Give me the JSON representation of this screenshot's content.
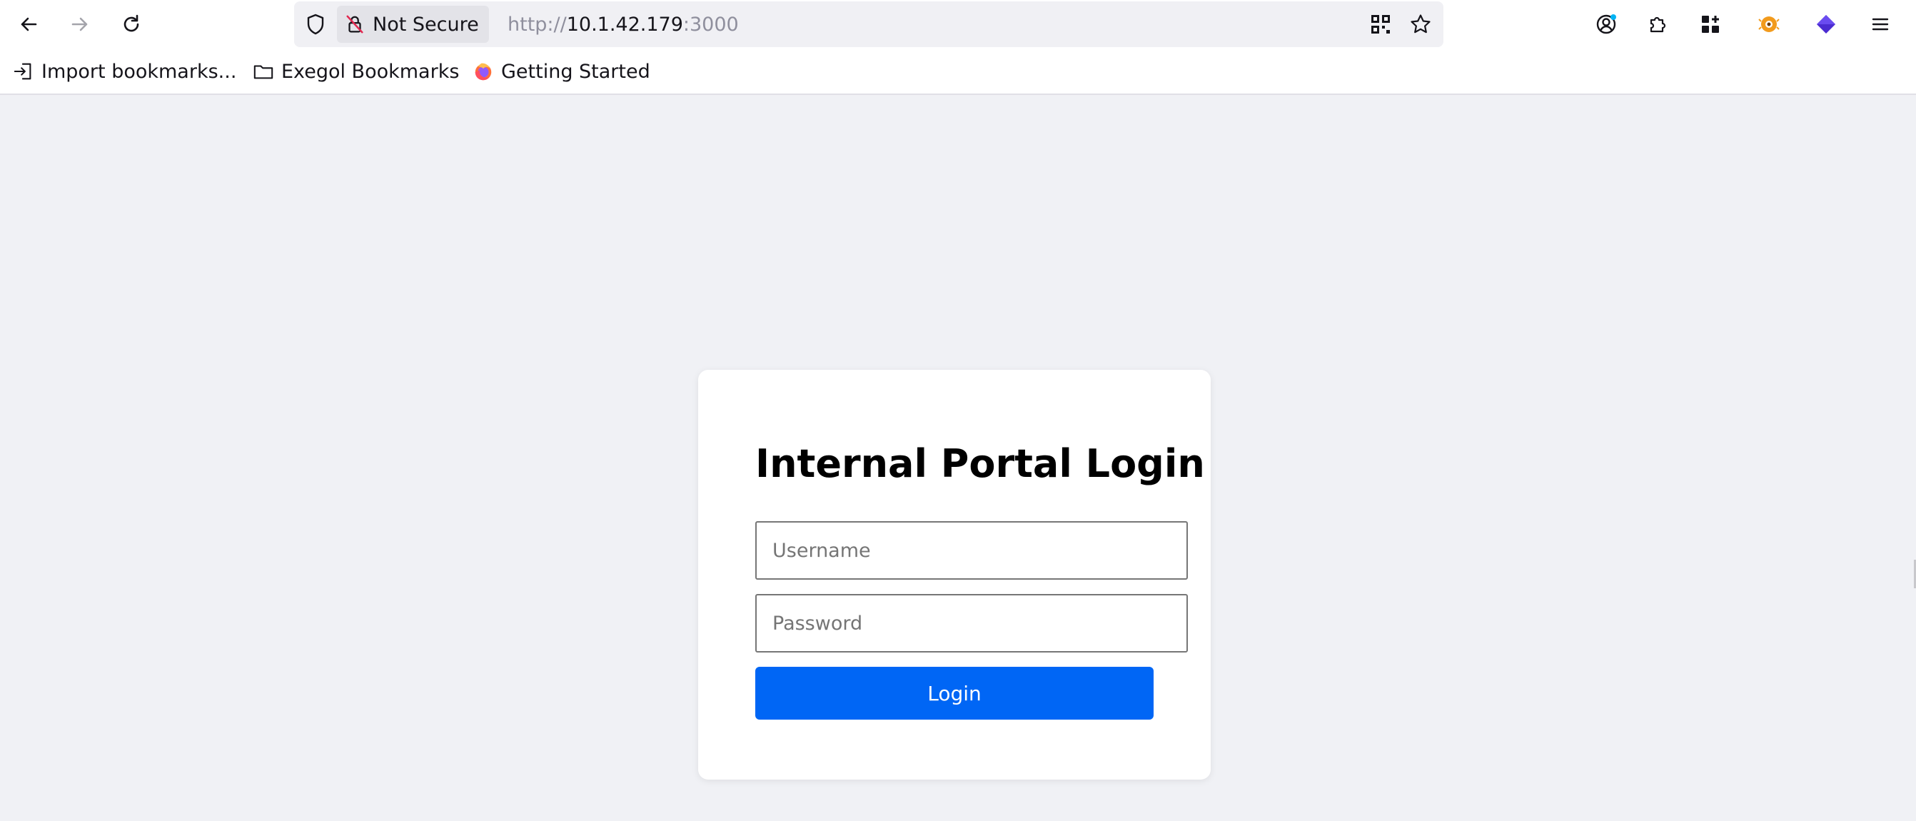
{
  "browser": {
    "security_label": "Not Secure",
    "url_scheme": "http://",
    "url_host": "10.1.42.179",
    "url_port": ":3000",
    "icons": {
      "back": "back-arrow-icon",
      "forward": "forward-arrow-icon",
      "reload": "reload-icon",
      "shield": "shield-icon",
      "insecure": "insecure-lock-icon",
      "qr": "qr-code-icon",
      "bookmark_star": "star-icon",
      "account": "account-icon",
      "extensions": "puzzle-icon",
      "apps": "apps-grid-icon",
      "ext1": "orange-extension-icon",
      "ext2": "purple-extension-icon",
      "menu": "hamburger-menu-icon"
    },
    "colors": {
      "notification_dot": "#00b3f4",
      "ext_orange": "#f29b1d",
      "ext_purple": "#4b2bd1"
    }
  },
  "bookmarks": [
    {
      "label": "Import bookmarks...",
      "icon": "import-icon"
    },
    {
      "label": "Exegol Bookmarks",
      "icon": "folder-icon"
    },
    {
      "label": "Getting Started",
      "icon": "firefox-icon"
    }
  ],
  "login": {
    "title": "Internal Portal Login",
    "username_placeholder": "Username",
    "password_placeholder": "Password",
    "button_label": "Login",
    "button_color": "#0066f5"
  }
}
